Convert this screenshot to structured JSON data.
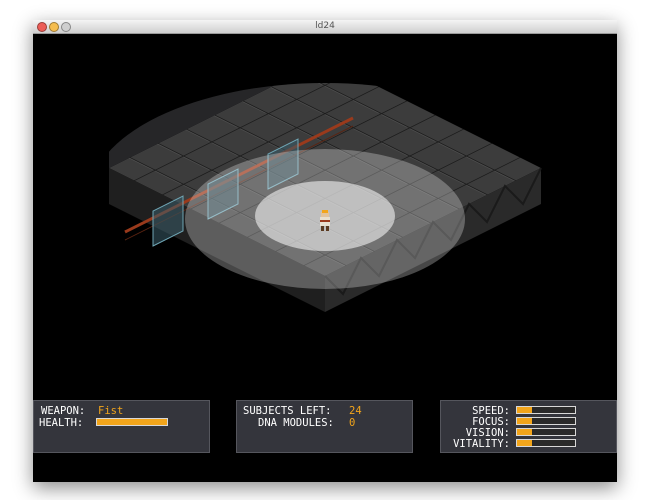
{
  "window": {
    "title": "ld24"
  },
  "hud": {
    "weapon": {
      "label": "WEAPON:",
      "value": "Fist"
    },
    "health": {
      "label": "HEALTH:",
      "level": 1.0
    },
    "subjects_left": {
      "label": "SUBJECTS LEFT:",
      "value": "24"
    },
    "dna_modules": {
      "label": "DNA MODULES:",
      "value": "0"
    },
    "stats": [
      {
        "label": "SPEED:",
        "level": 0.25
      },
      {
        "label": "FOCUS:",
        "level": 0.25
      },
      {
        "label": "VISION:",
        "level": 0.25
      },
      {
        "label": "VITALITY:",
        "level": 0.25
      }
    ]
  },
  "colors": {
    "accent": "#f2a51b",
    "panel_bg": "#34353c",
    "floor": "#3c3c3c",
    "rail": "#9a3a1c"
  }
}
